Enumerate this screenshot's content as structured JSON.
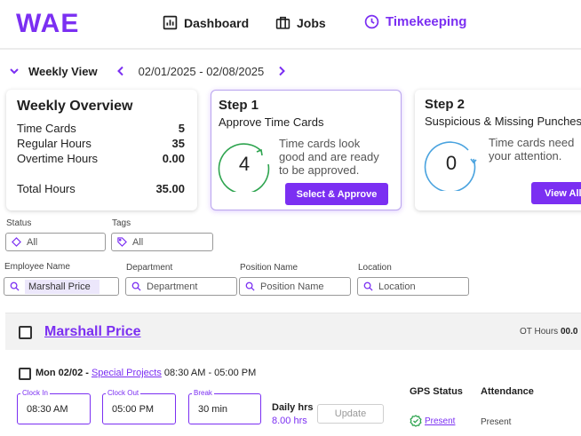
{
  "header": {
    "logo_text": "WAE",
    "nav": [
      {
        "label": "Dashboard"
      },
      {
        "label": "Jobs"
      },
      {
        "label": "Timekeeping"
      }
    ]
  },
  "week_bar": {
    "view_label": "Weekly View",
    "date_range": "02/01/2025 - 02/08/2025"
  },
  "overview": {
    "title": "Weekly Overview",
    "rows": [
      {
        "label": "Time Cards",
        "value": "5"
      },
      {
        "label": "Regular Hours",
        "value": "35"
      },
      {
        "label": "Overtime Hours",
        "value": "0.00"
      }
    ],
    "total_label": "Total Hours",
    "total_value": "35.00"
  },
  "step1": {
    "title": "Step 1",
    "subtitle": "Approve Time Cards",
    "count": "4",
    "text_lines": [
      "Time cards look",
      "good and are ready",
      "to be approved."
    ],
    "button": "Select & Approve",
    "ring_color": "#2ea44f"
  },
  "step2": {
    "title": "Step 2",
    "subtitle": "Suspicious & Missing Punches",
    "count": "0",
    "text_lines": [
      "Time cards need",
      "your attention."
    ],
    "button": "View All",
    "ring_color": "#4aa3df"
  },
  "filters": {
    "status": {
      "label": "Status",
      "value": "All"
    },
    "tags": {
      "label": "Tags",
      "value": "All"
    },
    "employee": {
      "label": "Employee Name",
      "value": "Marshall Price"
    },
    "department": {
      "label": "Department",
      "placeholder": "Department"
    },
    "position": {
      "label": "Position Name",
      "placeholder": "Position Name"
    },
    "location": {
      "label": "Location",
      "placeholder": "Location"
    }
  },
  "employee": {
    "name": "Marshall Price",
    "ot_label": "OT Hours",
    "ot_value": "00.0"
  },
  "day": {
    "date": "Mon 02/02 -",
    "project": "Special Projects",
    "hours": "08:30 AM - 05:00 PM",
    "clock_in_label": "Clock In",
    "clock_in": "08:30 AM",
    "clock_out_label": "Clock Out",
    "clock_out": "05:00 PM",
    "break_label": "Break",
    "break_value": "30 min",
    "daily_label": "Daily hrs",
    "daily_value": "8.00 hrs",
    "update_button": "Update",
    "gps_header": "GPS Status",
    "gps_value": "Present",
    "attendance_header": "Attendance",
    "attendance_value": "Present"
  },
  "colors": {
    "accent": "#7b2ff2",
    "success": "#2ea44f",
    "info": "#4aa3df"
  }
}
